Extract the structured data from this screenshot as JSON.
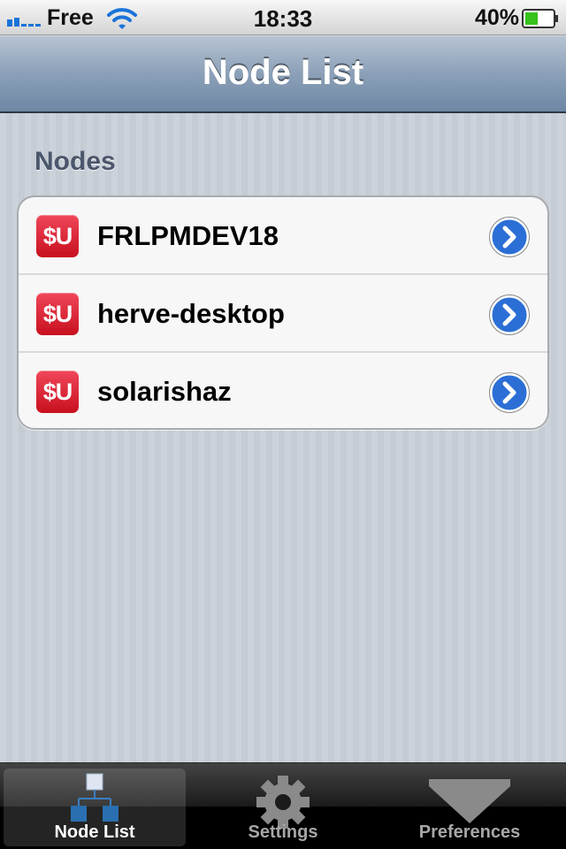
{
  "status_bar": {
    "carrier": "Free",
    "time": "18:33",
    "battery": "40%"
  },
  "nav_bar": {
    "title": "Node List"
  },
  "section": {
    "header": "Nodes"
  },
  "nodes": [
    {
      "icon_text": "$U",
      "name": "FRLPMDEV18"
    },
    {
      "icon_text": "$U",
      "name": "herve-desktop"
    },
    {
      "icon_text": "$U",
      "name": "solarishaz"
    }
  ],
  "tab_bar": {
    "tabs": [
      {
        "label": "Node List",
        "icon": "node-list-icon",
        "selected": true
      },
      {
        "label": "Settings",
        "icon": "gear-icon",
        "selected": false
      },
      {
        "label": "Preferences",
        "icon": "preferences-icon",
        "selected": false
      }
    ]
  },
  "colors": {
    "nav_bar": "#8ba0b8",
    "app_icon": "#d8192a",
    "disclosure": "#2b6fd6",
    "background": "#c5ccd4"
  }
}
